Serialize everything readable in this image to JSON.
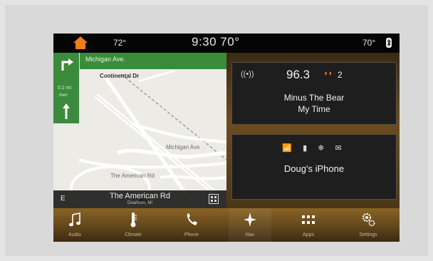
{
  "status": {
    "left_temp": "72°",
    "center": "9:30 70°",
    "right_temp": "70°",
    "home_icon": "home-icon",
    "bluetooth_icon": "bluetooth-icon"
  },
  "nav": {
    "street_top": "Michigan Ave.",
    "distance": "0.2 mi",
    "distance_unit": "then",
    "labels": {
      "continental": "Continental Dr",
      "michigan": "Michigan Ave",
      "american": "The American Rd"
    },
    "current_road": "The American Rd",
    "city": "Dearborn, MI",
    "heading": "E"
  },
  "radio": {
    "frequency": "96.3",
    "preset": "2",
    "artist": "Minus The Bear",
    "song": "My Time"
  },
  "phone": {
    "icons": "📶 ▮ ❄ ✉",
    "device": "Doug's iPhone"
  },
  "tray": {
    "buttons": [
      {
        "label": "Audio",
        "icon": "music-note-icon"
      },
      {
        "label": "Climate",
        "icon": "thermometer-icon"
      },
      {
        "label": "Phone",
        "icon": "phone-icon"
      },
      {
        "label": "Nav",
        "icon": "compass-star-icon"
      },
      {
        "label": "Apps",
        "icon": "apps-grid-icon"
      },
      {
        "label": "Settings",
        "icon": "gears-icon"
      }
    ]
  },
  "colors": {
    "home_accent": "#f07d16",
    "nav_green": "#3a8c3b",
    "tray_gold": "#8a6424"
  }
}
